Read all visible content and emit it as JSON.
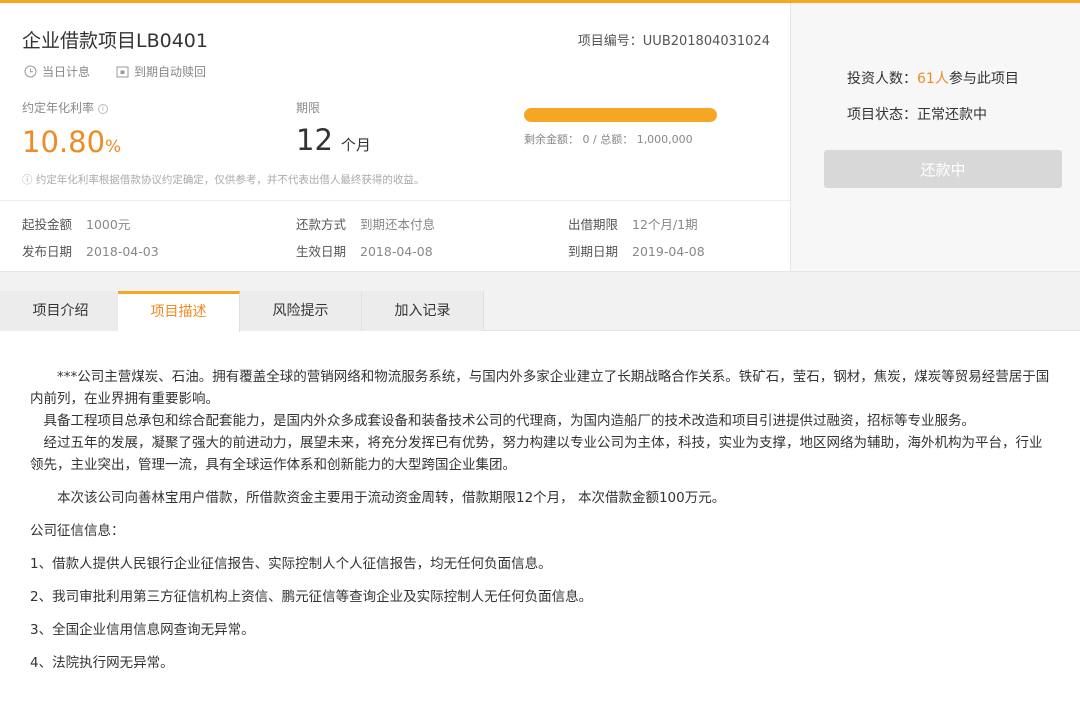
{
  "project": {
    "title": "企业借款项目LB0401",
    "project_no_label": "项目编号：",
    "project_no": "UUB201804031024",
    "tags": [
      {
        "icon": "clock-icon",
        "label": "当日计息"
      },
      {
        "icon": "calendar-icon",
        "label": "到期自动赎回"
      }
    ]
  },
  "stats": {
    "rate_label": "约定年化利率",
    "rate_value": "10.80",
    "rate_unit": "%",
    "term_label": "期限",
    "term_value": "12",
    "term_unit": "个月",
    "progress_fraction": 1.0,
    "remain_text": "剩余金额： 0 / 总额： 1,000,000",
    "disclaimer": "约定年化利率根据借款协议约定确定，仅供参考，并不代表出借人最终获得的收益。",
    "accent": "#f5a623"
  },
  "details": [
    {
      "key": "起投金额",
      "value": "1000元"
    },
    {
      "key": "还款方式",
      "value": "到期还本付息"
    },
    {
      "key": "出借期限",
      "value": "12个月/1期"
    },
    {
      "key": "发布日期",
      "value": "2018-04-03"
    },
    {
      "key": "生效日期",
      "value": "2018-04-08"
    },
    {
      "key": "到期日期",
      "value": "2019-04-08"
    }
  ],
  "side": {
    "investors_prefix": "投资人数：",
    "investors_count": "61人",
    "investors_suffix": "参与此项目",
    "status_label": "项目状态：",
    "status_value": "正常还款中",
    "button_label": "还款中"
  },
  "tabs": [
    {
      "label": "项目介绍"
    },
    {
      "label": "项目描述"
    },
    {
      "label": "风险提示"
    },
    {
      "label": "加入记录"
    }
  ],
  "content": {
    "paragraphs": [
      "　　***公司主营煤炭、石油。拥有覆盖全球的营销网络和物流服务系统，与国内外多家企业建立了长期战略合作关系。铁矿石，莹石，钢材，焦炭，煤炭等贸易经营居于国内前列，在业界拥有重要影响。",
      "　具备工程项目总承包和综合配套能力，是国内外众多成套设备和装备技术公司的代理商，为国内造船厂的技术改造和项目引进提供过融资，招标等专业服务。",
      "　经过五年的发展，凝聚了强大的前进动力，展望未来，将充分发挥已有优势，努力构建以专业公司为主体，科技，实业为支撑，地区网络为辅助，海外机构为平台，行业领先，主业突出，管理一流，具有全球运作体系和创新能力的大型跨国企业集团。",
      "　　本次该公司向善林宝用户借款，所借款资金主要用于流动资金周转，借款期限12个月， 本次借款金额100万元。",
      "公司征信信息：",
      "1、借款人提供人民银行企业征信报告、实际控制人个人征信报告，均无任何负面信息。",
      "2、我司审批利用第三方征信机构上资信、鹏元征信等查询企业及实际控制人无任何负面信息。",
      "3、全国企业信用信息网查询无异常。",
      "4、法院执行网无异常。"
    ]
  }
}
